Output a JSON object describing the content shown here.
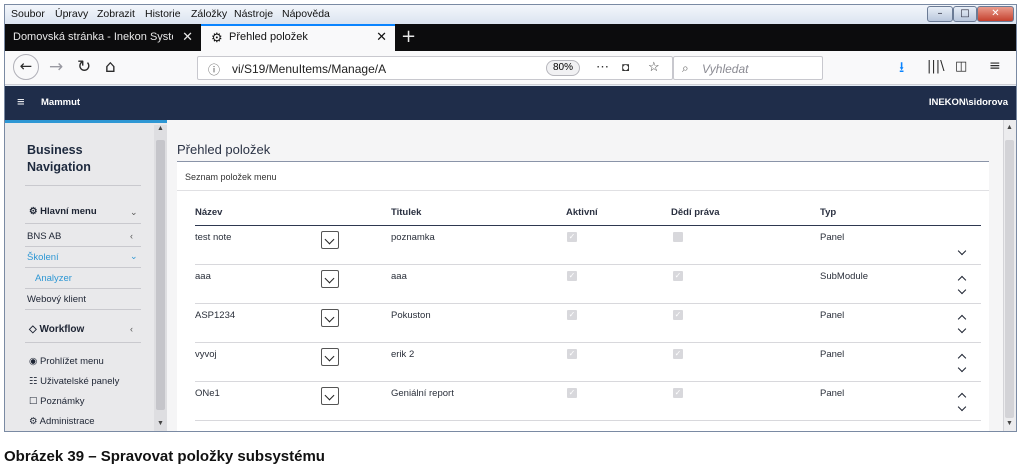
{
  "menubar": {
    "items": [
      "Soubor",
      "Úpravy",
      "Zobrazit",
      "Historie",
      "Záložky",
      "Nástroje",
      "Nápověda"
    ]
  },
  "tabs": [
    {
      "label": "Domovská stránka - Inekon System"
    },
    {
      "label": "Přehled položek"
    }
  ],
  "navbar": {
    "url": "vi/S19/MenuItems/Manage/A",
    "zoom": "80%",
    "search_placeholder": "Vyhledat"
  },
  "app": {
    "brand": "Mammut",
    "user": "INEKON\\sidorova"
  },
  "sidebar": {
    "title_line1": "Business",
    "title_line2": "Navigation",
    "main_menu": "Hlavní menu",
    "items": [
      "BNS AB",
      "Školení",
      "Analyzer",
      "Webový klient"
    ],
    "workflow": "Workflow",
    "tools": [
      "Prohlížet menu",
      "Uživatelské panely",
      "Poznámky",
      "Administrace"
    ]
  },
  "page": {
    "title": "Přehled položek",
    "panel_title": "Seznam položek menu"
  },
  "table": {
    "headers": [
      "Název",
      "Titulek",
      "Aktivní",
      "Dědí práva",
      "Typ"
    ],
    "rows": [
      {
        "name": "test note",
        "title": "poznamka",
        "active": true,
        "inherits": false,
        "type": "Panel"
      },
      {
        "name": "aaa",
        "title": "aaa",
        "active": true,
        "inherits": true,
        "type": "SubModule"
      },
      {
        "name": "ASP1234",
        "title": "Pokuston",
        "active": true,
        "inherits": true,
        "type": "Panel"
      },
      {
        "name": "vyvoj",
        "title": "erik 2",
        "active": true,
        "inherits": true,
        "type": "Panel"
      },
      {
        "name": "ONe1",
        "title": "Geniální report",
        "active": true,
        "inherits": true,
        "type": "Panel"
      }
    ]
  },
  "caption": "Obrázek 39 – Spravovat položky subsystému",
  "colors": {
    "app_header": "#1f2d4a",
    "accent": "#2e97d4",
    "tab_active_accent": "#0a84ff",
    "download_icon": "#0a84ff"
  }
}
